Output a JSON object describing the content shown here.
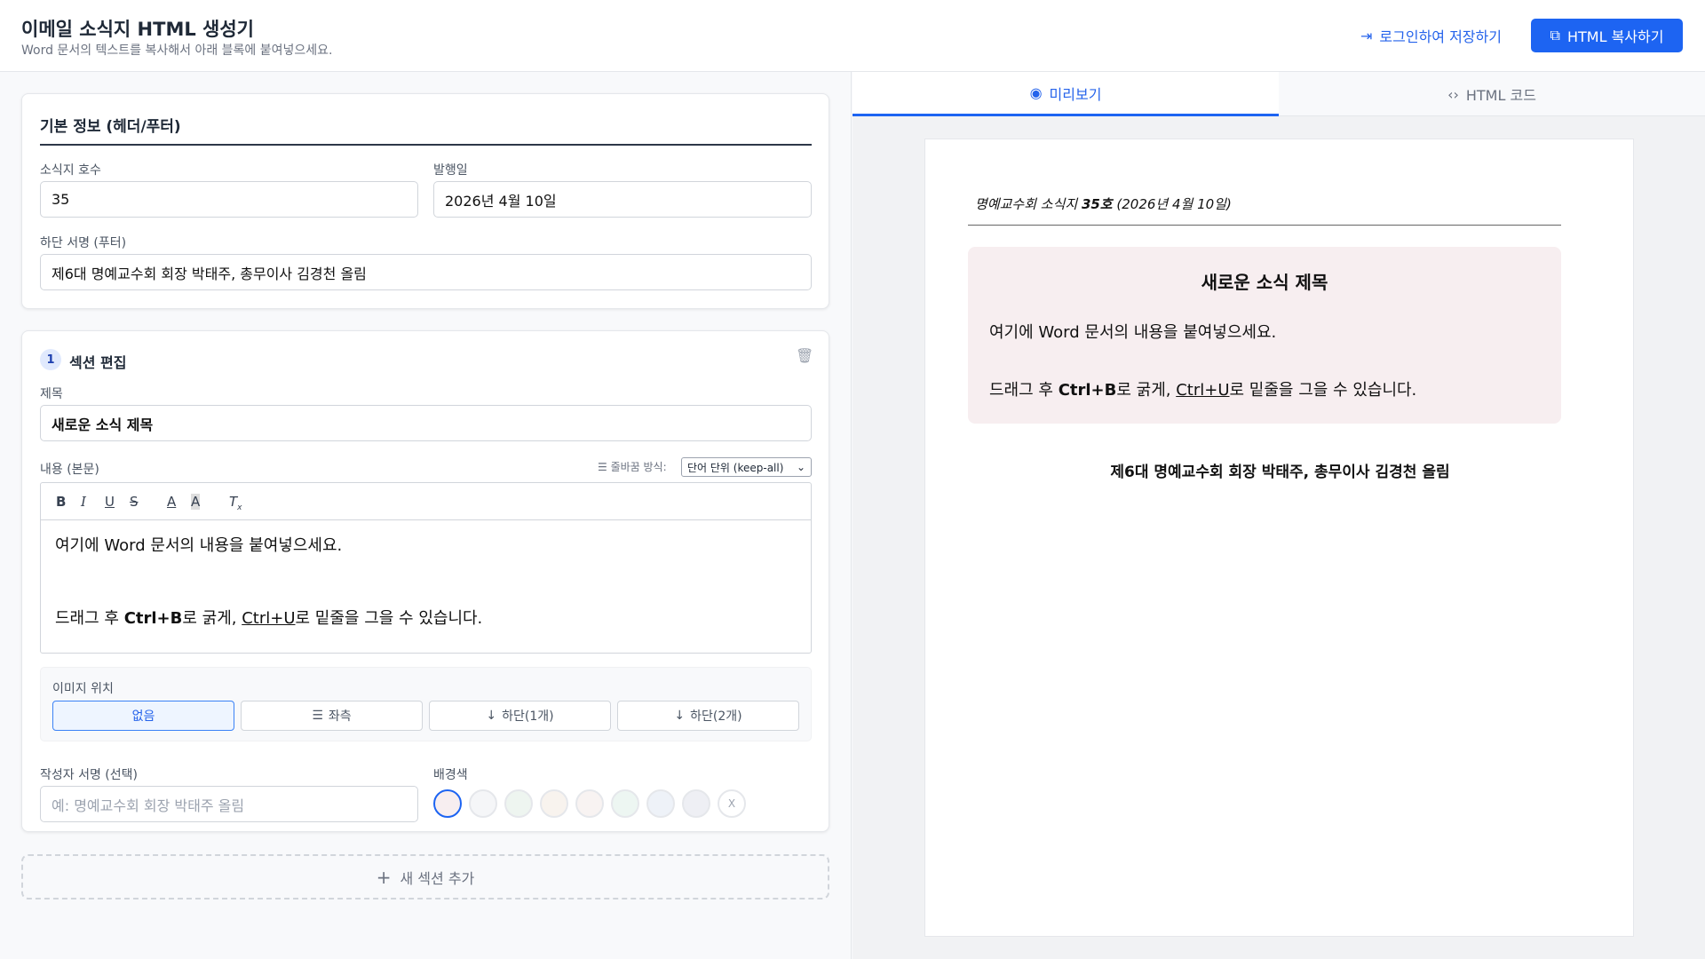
{
  "header": {
    "title": "이메일 소식지 HTML 생성기",
    "subtitle": "Word 문서의 텍스트를 복사해서 아래 블록에 붙여넣으세요.",
    "login_label": "로그인하여 저장하기",
    "copy_label": "HTML 복사하기"
  },
  "basic": {
    "title": "기본 정보 (헤더/푸터)",
    "issue_label": "소식지 호수",
    "issue_value": "35",
    "date_label": "발행일",
    "date_value": "2026년 4월 10일",
    "footer_label": "하단 서명 (푸터)",
    "footer_value": "제6대 명예교수회 회장 박태주, 총무이사 김경천 올림"
  },
  "section": {
    "number": "1",
    "title": "섹션 편집",
    "title_label": "제목",
    "title_value": "새로운 소식 제목",
    "content_label": "내용 (본문)",
    "wrap_label": "줄바꿈 방식:",
    "wrap_value": "단어 단위 (keep-all)",
    "content": {
      "p1": "여기에 Word 문서의 내용을 붙여넣으세요.",
      "p2_a": "드래그 후 ",
      "p2_b": "Ctrl+B",
      "p2_c": "로 굵게, ",
      "p2_d": "Ctrl+U",
      "p2_e": "로 밑줄을 그을 수 있습니다."
    },
    "image_label": "이미지 위치",
    "image_options": [
      "없음",
      "좌측",
      "하단(1개)",
      "하단(2개)"
    ],
    "image_selected": "없음",
    "author_label": "작성자 서명 (선택)",
    "author_placeholder": "예: 명예교수회 회장 박태주 올림",
    "bg_label": "배경색",
    "bg_colors": [
      "#f7eef0",
      "#f5f6f8",
      "#eef5f0",
      "#f8f3ee",
      "#f8f3f2",
      "#edf6f2",
      "#eef2f8",
      "#eeeff4"
    ],
    "bg_clear": "X"
  },
  "add_section": "새 섹션 추가",
  "tabs": {
    "preview": "미리보기",
    "code": "HTML 코드"
  },
  "preview": {
    "header_a": "명예교수회 소식지 ",
    "header_b": "35호",
    "header_c": " (2026년 4월 10일)",
    "title": "새로운 소식 제목",
    "footer": "제6대 명예교수회 회장 박태주, 총무이사 김경천 올림",
    "accent": "#1d64f2"
  }
}
